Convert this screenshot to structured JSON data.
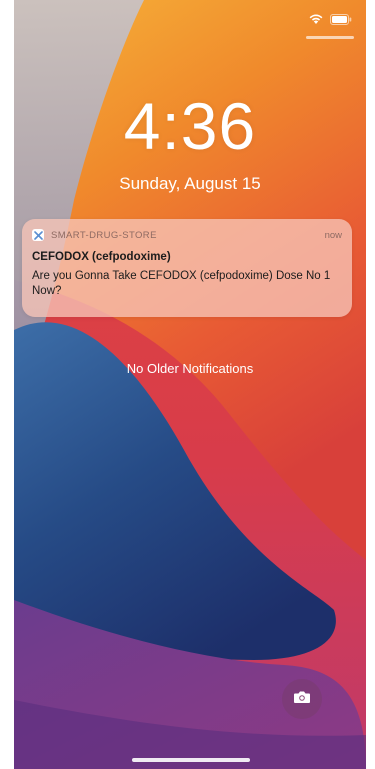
{
  "lock_screen": {
    "time": "4:36",
    "date": "Sunday, August 15",
    "no_older_notifications": "No Older Notifications"
  },
  "notification": {
    "app_name": "SMART-DRUG-STORE",
    "time": "now",
    "title": "CEFODOX (cefpodoxime)",
    "body": "Are you Gonna Take CEFODOX (cefpodoxime) Dose No 1 Now?"
  },
  "icons": {
    "wifi": "wifi-icon",
    "battery": "battery-icon",
    "app": "app-icon",
    "camera": "camera-icon"
  },
  "colors": {
    "wallpaper_orange": "#f29c2e",
    "wallpaper_red": "#d9472f",
    "wallpaper_blue": "#2b4f8a",
    "notification_bg": "#f6c4b7"
  }
}
